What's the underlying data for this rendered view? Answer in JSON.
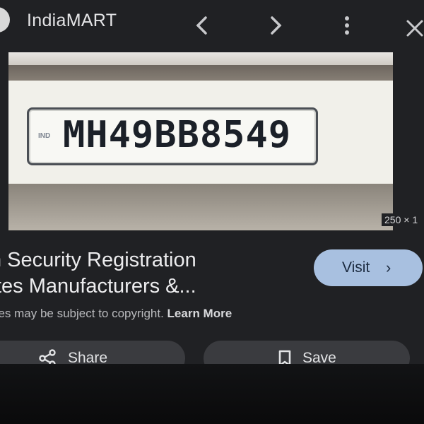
{
  "header": {
    "site_name": "IndiaMART",
    "back_icon": "chevron-left-icon",
    "forward_icon": "chevron-right-icon",
    "menu_icon": "more-vert-icon",
    "close_icon": "close-icon"
  },
  "image": {
    "plate_prefix": "IND",
    "plate_number": "MH49BB8549",
    "dimensions": "250 × 1"
  },
  "result": {
    "title_line1": "h Security Registration",
    "title_line2": "tes Manufacturers &...",
    "visit_label": "Visit",
    "copyright_text": "ges may be subject to copyright.",
    "learn_more": "Learn More"
  },
  "actions": {
    "share_label": "Share",
    "save_label": "Save"
  },
  "colors": {
    "background": "#202124",
    "visit_button": "#a8c0e0",
    "pill_button": "#3a3b3f"
  }
}
